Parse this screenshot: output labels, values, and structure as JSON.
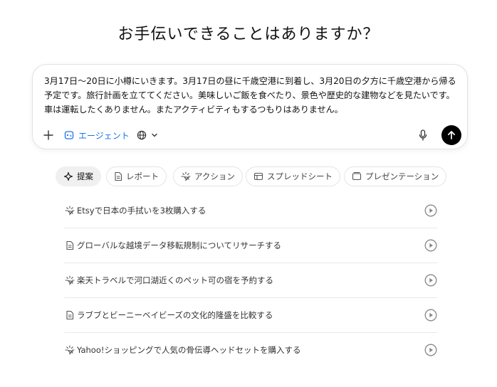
{
  "headline": "お手伝いできることはありますか？",
  "composer": {
    "text": "3月17日〜20日に小樽にいきます。3月17日の昼に千歳空港に到着し、3月20日の夕方に千歳空港から帰る予定です。旅行計画を立ててください。美味しいご飯を食べたり、景色や歴史的な建物などを見たいです。車は運転したくありません。またアクティビティもするつもりはありません。",
    "agent_label": "エージェント",
    "accent": "#1a73e8"
  },
  "chips": [
    {
      "label": "提案",
      "icon": "sparkle-icon"
    },
    {
      "label": "レポート",
      "icon": "document-icon"
    },
    {
      "label": "アクション",
      "icon": "action-sparkle-icon"
    },
    {
      "label": "スプレッドシート",
      "icon": "table-icon"
    },
    {
      "label": "プレゼンテーション",
      "icon": "slides-icon"
    }
  ],
  "suggestions": [
    {
      "text": "Etsyで日本の手拭いを3枚購入する",
      "icon": "action-sparkle-icon"
    },
    {
      "text": "グローバルな越境データ移転規制についてリサーチする",
      "icon": "document-icon"
    },
    {
      "text": "楽天トラベルで河口湖近くのペット可の宿を予約する",
      "icon": "action-sparkle-icon"
    },
    {
      "text": "ラブブとビーニーベイビーズの文化的隆盛を比較する",
      "icon": "document-icon"
    },
    {
      "text": "Yahoo!ショッピングで人気の骨伝導ヘッドセットを購入する",
      "icon": "action-sparkle-icon"
    }
  ]
}
